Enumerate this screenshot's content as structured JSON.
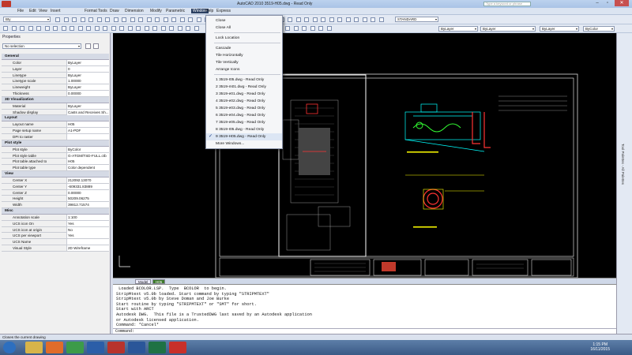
{
  "app": {
    "title": "AutoCAD 2010    3519-H05.dwg - Read Only",
    "search_placeholder": "Type a keyword or phrase"
  },
  "menubar": [
    "File",
    "Edit",
    "View",
    "Insert",
    "Format",
    "Tools",
    "Draw",
    "Dimension",
    "Modify",
    "Parametric",
    "Window",
    "Help",
    "Express"
  ],
  "toolbar": {
    "layer_combo": "Bty",
    "style_combo": "STANDARD",
    "bylayer_1": "ByLayer",
    "bylayer_2": "ByLayer",
    "bylayer_3": "ByLayer",
    "bycolor": "ByColor"
  },
  "properties": {
    "title": "Properties",
    "selection": "No selection",
    "sections": [
      {
        "name": "General",
        "rows": [
          [
            "Color",
            "ByLayer"
          ],
          [
            "Layer",
            "0"
          ],
          [
            "Linetype",
            "ByLayer"
          ],
          [
            "Linetype scale",
            "1.00000"
          ],
          [
            "Lineweight",
            "ByLayer"
          ],
          [
            "Thickness",
            "0.00000"
          ]
        ]
      },
      {
        "name": "3D Visualization",
        "rows": [
          [
            "Material",
            "ByLayer"
          ],
          [
            "Shadow display",
            "Casts and Receives Sh..."
          ]
        ]
      },
      {
        "name": "Layout",
        "rows": [
          [
            "Layout name",
            "H05"
          ],
          [
            "Page setup name",
            "A1-PDF"
          ],
          [
            "DPI to raster",
            ""
          ]
        ]
      },
      {
        "name": "Plot style",
        "rows": [
          [
            "Plot style",
            "ByColor"
          ],
          [
            "Plot style table",
            "G-ATGM/TSD-FULL.ctb"
          ],
          [
            "Plot table attached to",
            "H05"
          ],
          [
            "Plot table type",
            "Color dependent"
          ]
        ]
      },
      {
        "name": "View",
        "rows": [
          [
            "Center X",
            "212092.13070"
          ],
          [
            "Center Y",
            "-609331.83889"
          ],
          [
            "Center Z",
            "0.00000"
          ],
          [
            "Height",
            "50209.06275"
          ],
          [
            "Width",
            "39812.71574"
          ]
        ]
      },
      {
        "name": "Misc",
        "rows": [
          [
            "Annotation scale",
            "1:100"
          ],
          [
            "UCS icon On",
            "Yes"
          ],
          [
            "UCS icon at origin",
            "No"
          ],
          [
            "UCS per viewport",
            "Yes"
          ],
          [
            "UCS Name",
            ""
          ],
          [
            "Visual Style",
            "2D Wireframe"
          ]
        ]
      }
    ]
  },
  "window_menu": {
    "items": [
      "Close",
      "Close All",
      "Lock Location",
      "Cascade",
      "Tile Horizontally",
      "Tile Vertically",
      "Arrange Icons"
    ],
    "documents": [
      "1 3519-I05.dwg - Read Only",
      "2 3519-m01.dwg - Read Only",
      "3 3519-e01.dwg - Read Only",
      "4 3519-e02.dwg - Read Only",
      "5 3519-e03.dwg - Read Only",
      "6 3519-e04.dwg - Read Only",
      "7 3519-e05.dwg - Read Only",
      "8 3519-I05.dwg - Read Only",
      "9 3519-H05.dwg - Read Only"
    ],
    "checked_index": 8,
    "more": "More Windows..."
  },
  "tabs": {
    "model": "Model",
    "layout": "H05"
  },
  "command_history": [
    " Loaded BCOLOR.LSP.  Type  BCOLOR  to begin.",
    "StripMtext v5.0b loaded. Start command by typing \"STRIPMTEXT\"",
    "StripMtext v5.0b by Steve Doman and Joe Burke",
    "Start routine by typing \"STRIPMTEXT\" or \"SMT\" for short.",
    "Start with ARCT",
    "Autodesk DWG.  This file is a TrustedDWG last saved by an Autodesk application",
    "or Autodesk licensed application.",
    "Command: *Cancel*"
  ],
  "command_prompt": "Command:",
  "status_text": "Closes the current drawing",
  "right_palette_label": "Tool Palettes - All Palettes",
  "clock": {
    "time": "1:15 PM",
    "date": "16/11/2015"
  },
  "colors": {
    "canvas": "#000000",
    "menu_active": "#2a3f61",
    "drawing_cyan": "#00ffff",
    "drawing_yellow": "#ffff00",
    "drawing_red": "#ff3333",
    "drawing_green": "#33ff33"
  }
}
